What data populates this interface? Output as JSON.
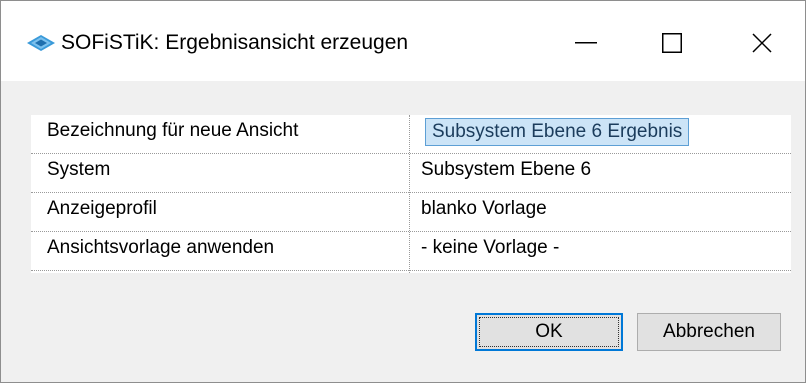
{
  "window": {
    "title": "SOFiSTiK: Ergebnisansicht erzeugen",
    "icon": "sofistik-logo-icon",
    "controls": [
      "minimize-icon",
      "maximize-icon",
      "close-icon"
    ]
  },
  "properties": {
    "rows": [
      {
        "label": "Bezeichnung für neue Ansicht",
        "value": "Subsystem Ebene 6 Ergebnis"
      },
      {
        "label": "System",
        "value": "Subsystem Ebene 6"
      },
      {
        "label": "Anzeigeprofil",
        "value": "blanko Vorlage"
      },
      {
        "label": "Ansichtsvorlage anwenden",
        "value": "- keine Vorlage -"
      }
    ]
  },
  "buttons": {
    "ok_label": "OK",
    "cancel_label": "Abbrechen"
  },
  "colors": {
    "selection_bg": "#cce4f7",
    "selection_border": "#5d9fd5",
    "default_button_border": "#0078d7",
    "logo_blue": "#3a9ad9"
  }
}
